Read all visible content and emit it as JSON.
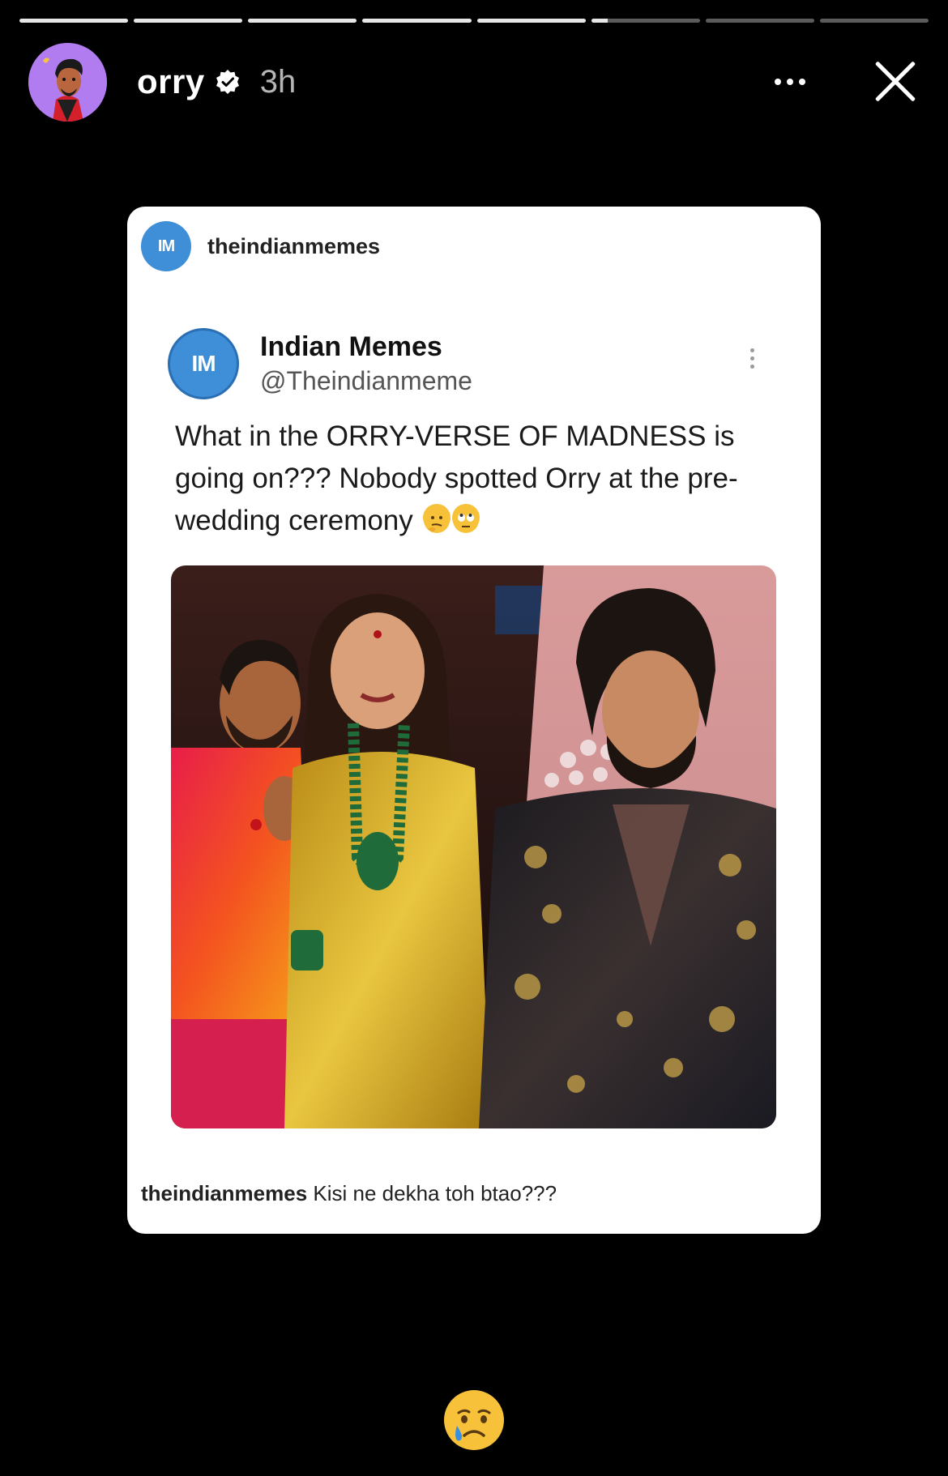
{
  "story": {
    "progress": {
      "segments": 8,
      "completed": 5,
      "current_fraction": 0.15
    },
    "header": {
      "username": "orry",
      "time_ago": "3h",
      "avatar_icon": "cartoon-avatar-icon",
      "verified_icon": "verified-badge-icon",
      "more_icon": "more-options-icon",
      "close_icon": "close-icon"
    },
    "shared_post": {
      "account_badge": "IM",
      "account_name": "theindianmemes",
      "tweet": {
        "avatar_badge": "IM",
        "display_name": "Indian Memes",
        "handle": "@Theindianmeme",
        "text": "What in the ORRY-VERSE OF MADNESS is going on??? Nobody spotted Orry at the pre-wedding ceremony",
        "emojis": [
          "thinking-face-emoji",
          "rolling-eyes-emoji"
        ]
      },
      "caption_user": "theindianmemes",
      "caption_text": " Kisi ne dekha toh btao???"
    },
    "reaction_sticker": "crying-face-emoji"
  },
  "colors": {
    "background": "#000000",
    "avatar_bg": "#b07cf0",
    "im_blue": "#3f8ed8",
    "card_bg": "#ffffff"
  }
}
